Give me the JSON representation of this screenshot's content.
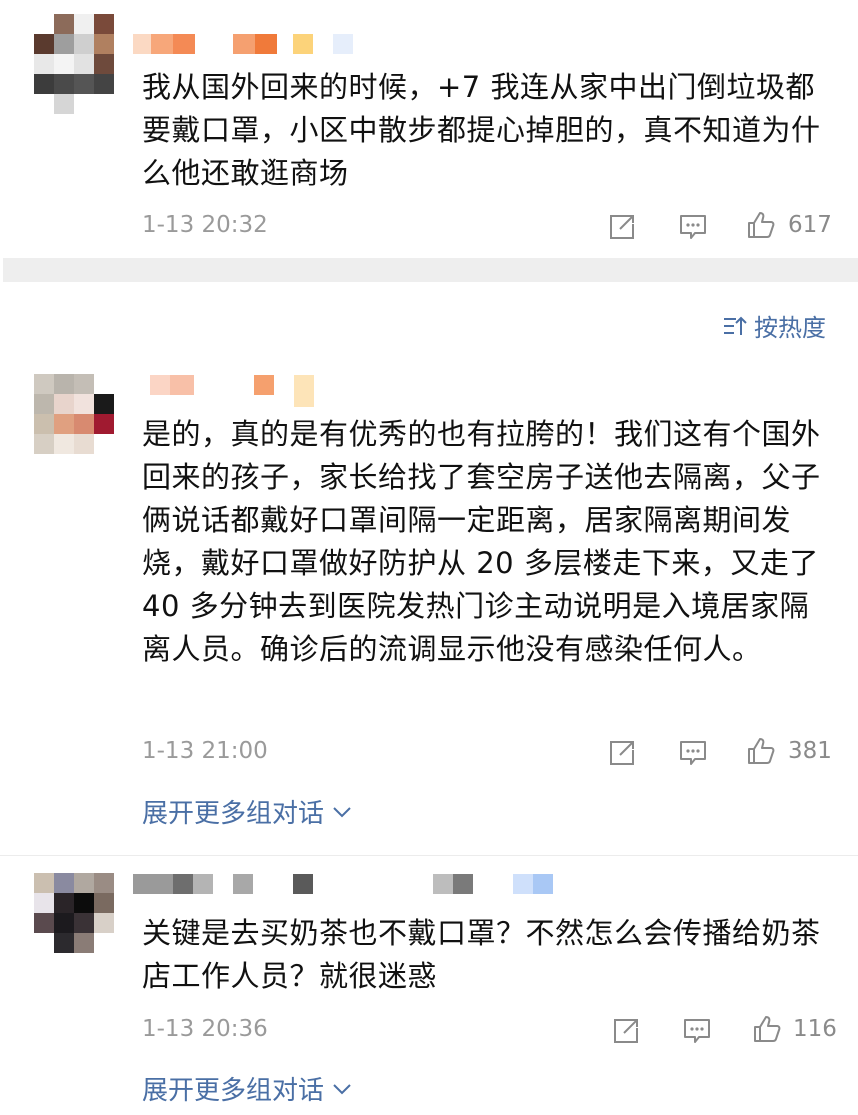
{
  "comments": [
    {
      "text": "我从国外回来的时候，+7 我连从家中出门倒垃圾都要戴口罩，小区中散步都提心掉胆的，真不知道为什么他还敢逛商场",
      "time": "1-13 20:32",
      "likes": "617"
    },
    {
      "text": "是的，真的是有优秀的也有拉胯的！我们这有个国外回来的孩子，家长给找了套空房子送他去隔离，父子俩说话都戴好口罩间隔一定距离，居家隔离期间发烧，戴好口罩做好防护从 20 多层楼走下来，又走了 40 多分钟去到医院发热门诊主动说明是入境居家隔离人员。确诊后的流调显示他没有感染任何人。",
      "time": "1-13 21:00",
      "likes": "381",
      "expand": "展开更多组对话"
    },
    {
      "text": "关键是去买奶茶也不戴口罩？不然怎么会传播给奶茶店工作人员？就很迷惑",
      "time": "1-13 20:36",
      "likes": "116",
      "expand": "展开更多组对话"
    }
  ],
  "sort_label": "按热度",
  "icons": {
    "share": "share-icon",
    "comment": "comment-icon",
    "like": "thumbs-up-icon",
    "sort": "sort-icon",
    "expand": "chevron-down-icon"
  },
  "colors": {
    "link": "#4a6fa5",
    "meta": "#9a9a9a",
    "divider": "#eeeeee"
  }
}
